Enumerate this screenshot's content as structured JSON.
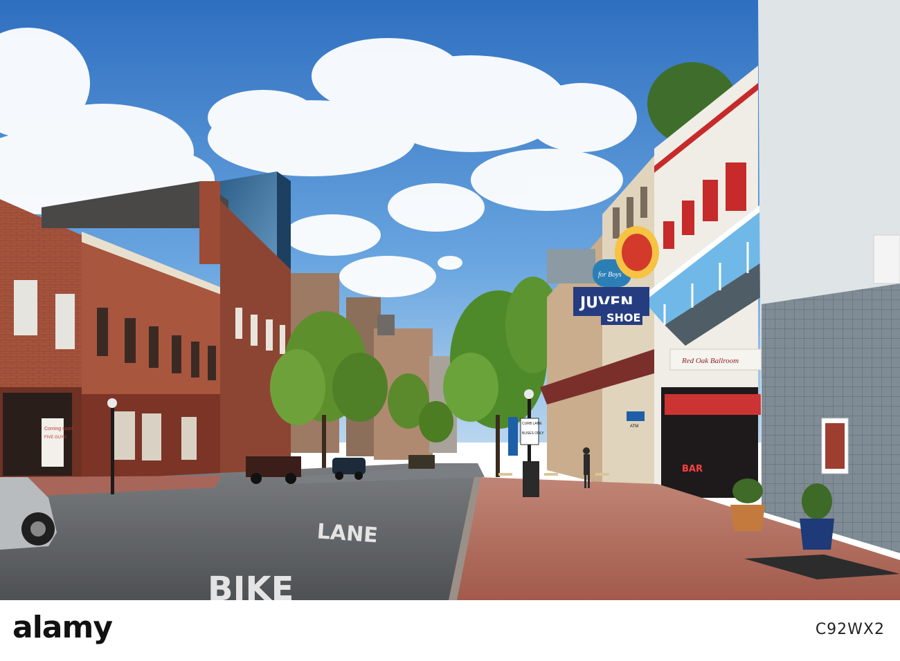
{
  "photo": {
    "signs": {
      "juvenile": "JUVEN",
      "shoe": "SHOE",
      "for_boys": "for Boys",
      "ballroom": "Red Oak Ballroom",
      "curb_lane": "CURB LANE",
      "buses_only": "BUSES ONLY",
      "atm": "ATM",
      "bar": "BAR",
      "five_guys": "FIVE GUYS",
      "coming_soon": "Coming soon"
    },
    "road_text": {
      "lane": "LANE",
      "bike": "BIKE"
    }
  },
  "footer": {
    "logo": "alamy",
    "stock_id": "C92WX2"
  },
  "colors": {
    "sky_top": "#2f6fc0",
    "sky_bottom": "#8fbde8",
    "brick": "#a5533d",
    "awning_blue": "#6fb8e8",
    "road": "#5f6266",
    "sidewalk": "#b06a5c"
  }
}
